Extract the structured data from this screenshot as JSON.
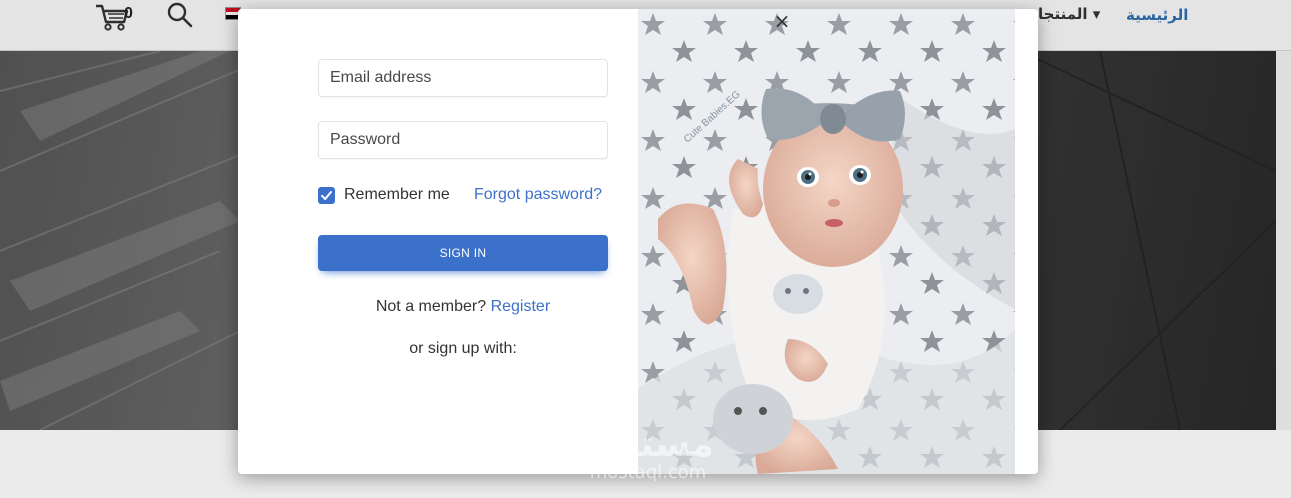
{
  "nav": {
    "home_label": "الرئيسية",
    "products_label": "المنتجا",
    "cart_count": "0"
  },
  "login": {
    "email_placeholder": "Email address",
    "password_placeholder": "Password",
    "remember_label": "Remember me",
    "remember_checked": true,
    "forgot_label": "Forgot password?",
    "signin_label": "SIGN IN",
    "not_member_text": "Not a member?",
    "register_label": "Register",
    "signup_with_text": "or sign up with:",
    "close_label": "×"
  },
  "image": {
    "photo_watermark": "Cute Babies.EG"
  },
  "watermark": {
    "arabic": "مستقل",
    "latin": "mostaql.com"
  },
  "colors": {
    "primary": "#3b71ca",
    "nav_home": "#2f6fb0"
  }
}
